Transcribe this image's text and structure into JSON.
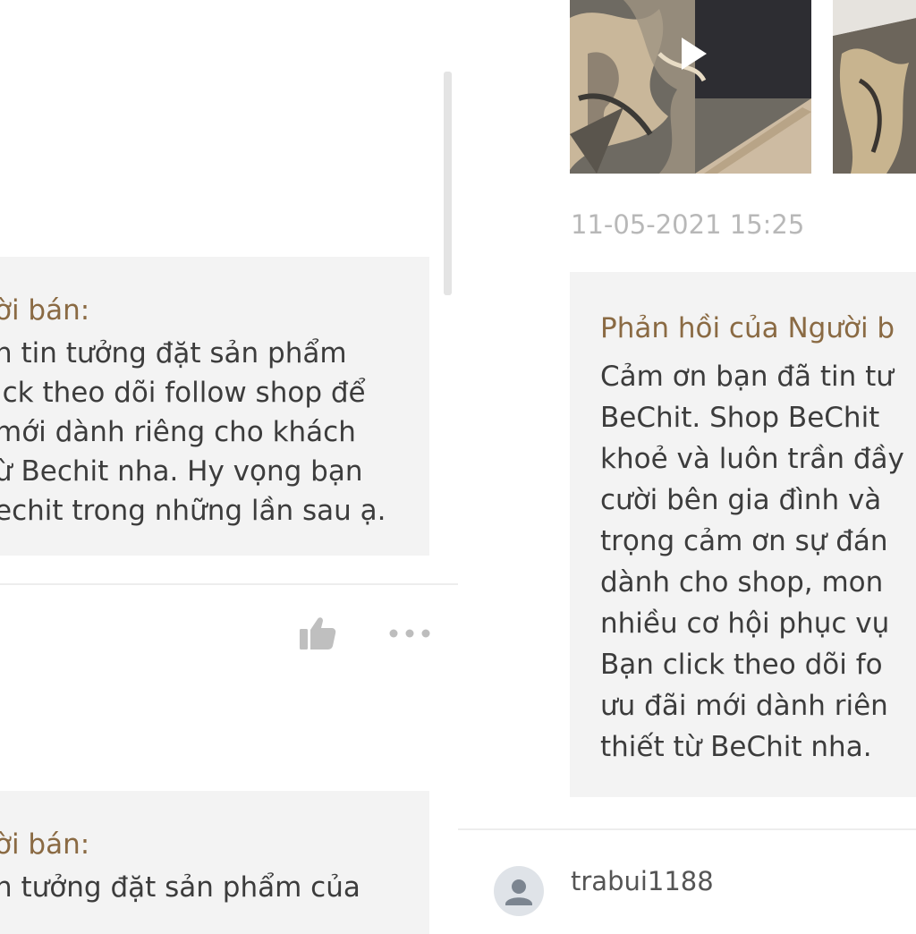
{
  "left_pane": {
    "reply1": {
      "title": "ời bán:",
      "lines": [
        "n tin tưởng đặt sản phẩm",
        "ick theo dõi follow shop để",
        "mới dành riêng cho khách",
        "ừ Bechit nha. Hy vọng bạn",
        "echit trong những lần sau ạ."
      ]
    },
    "reply2": {
      "title": "ời bán:",
      "lines": [
        "n tưởng đặt sản phẩm của"
      ]
    },
    "actions": {
      "like_icon": "thumbs-up-icon",
      "more_icon": "more-horizontal-icon"
    }
  },
  "right_pane": {
    "media": {
      "play_icon": "play-icon"
    },
    "timestamp": "11-05-2021 15:25",
    "reply": {
      "title": "Phản hồi của Người b",
      "lines": [
        "Cảm ơn bạn đã tin tư",
        "BeChit. Shop BeChit",
        "khoẻ và luôn trần đầy",
        "cười bên gia đình và",
        "trọng cảm ơn sự đán",
        "dành cho shop, mon",
        "nhiều cơ hội phục vụ",
        "Bạn click theo dõi fo",
        "ưu đãi mới dành riên",
        "thiết từ BeChit nha."
      ]
    },
    "next_review": {
      "avatar_icon": "user-avatar-icon",
      "username": "trabui1188"
    }
  }
}
